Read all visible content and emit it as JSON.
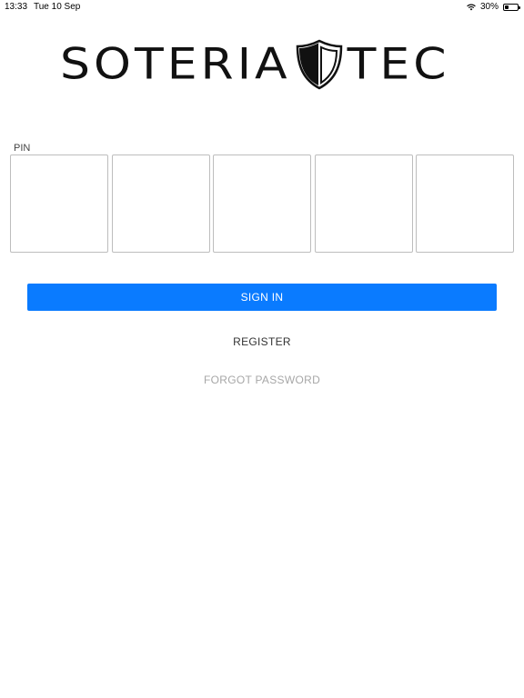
{
  "status_bar": {
    "time": "13:33",
    "date": "Tue 10 Sep",
    "battery": "30%",
    "battery_level": 0.3
  },
  "logo": {
    "left_text": "SOTERIA",
    "right_text": "TEC",
    "shield_icon": "shield-icon"
  },
  "pin": {
    "label": "PIN",
    "boxes": [
      "",
      "",
      "",
      "",
      ""
    ]
  },
  "actions": {
    "sign_in": "SIGN IN",
    "register": "REGISTER",
    "forgot_password": "FORGOT PASSWORD"
  },
  "colors": {
    "accent": "#0a7bff",
    "muted": "#a7a7a7"
  }
}
